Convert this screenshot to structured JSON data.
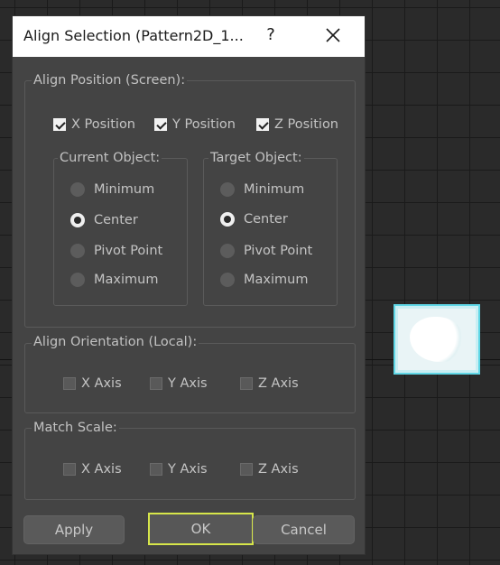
{
  "dialog": {
    "title": "Align Selection (Pattern2D_1...",
    "help_glyph": "?",
    "close_icon": "close-icon"
  },
  "align_position": {
    "label": "Align Position (Screen):",
    "checks": [
      {
        "label": "X Position",
        "checked": true
      },
      {
        "label": "Y Position",
        "checked": true
      },
      {
        "label": "Z Position",
        "checked": true
      }
    ],
    "current_object": {
      "label": "Current Object:",
      "options": [
        "Minimum",
        "Center",
        "Pivot Point",
        "Maximum"
      ],
      "selected": "Center"
    },
    "target_object": {
      "label": "Target Object:",
      "options": [
        "Minimum",
        "Center",
        "Pivot Point",
        "Maximum"
      ],
      "selected": "Center"
    }
  },
  "align_orientation": {
    "label": "Align Orientation (Local):",
    "checks": [
      {
        "label": "X Axis",
        "checked": false
      },
      {
        "label": "Y Axis",
        "checked": false
      },
      {
        "label": "Z Axis",
        "checked": false
      }
    ]
  },
  "match_scale": {
    "label": "Match Scale:",
    "checks": [
      {
        "label": "X Axis",
        "checked": false
      },
      {
        "label": "Y Axis",
        "checked": false
      },
      {
        "label": "Z Axis",
        "checked": false
      }
    ]
  },
  "buttons": {
    "apply": "Apply",
    "ok": "OK",
    "cancel": "Cancel"
  },
  "colors": {
    "dialog_bg": "#444444",
    "default_button_border": "#d7e64a",
    "selected_object_outline": "#5fd7e6"
  }
}
